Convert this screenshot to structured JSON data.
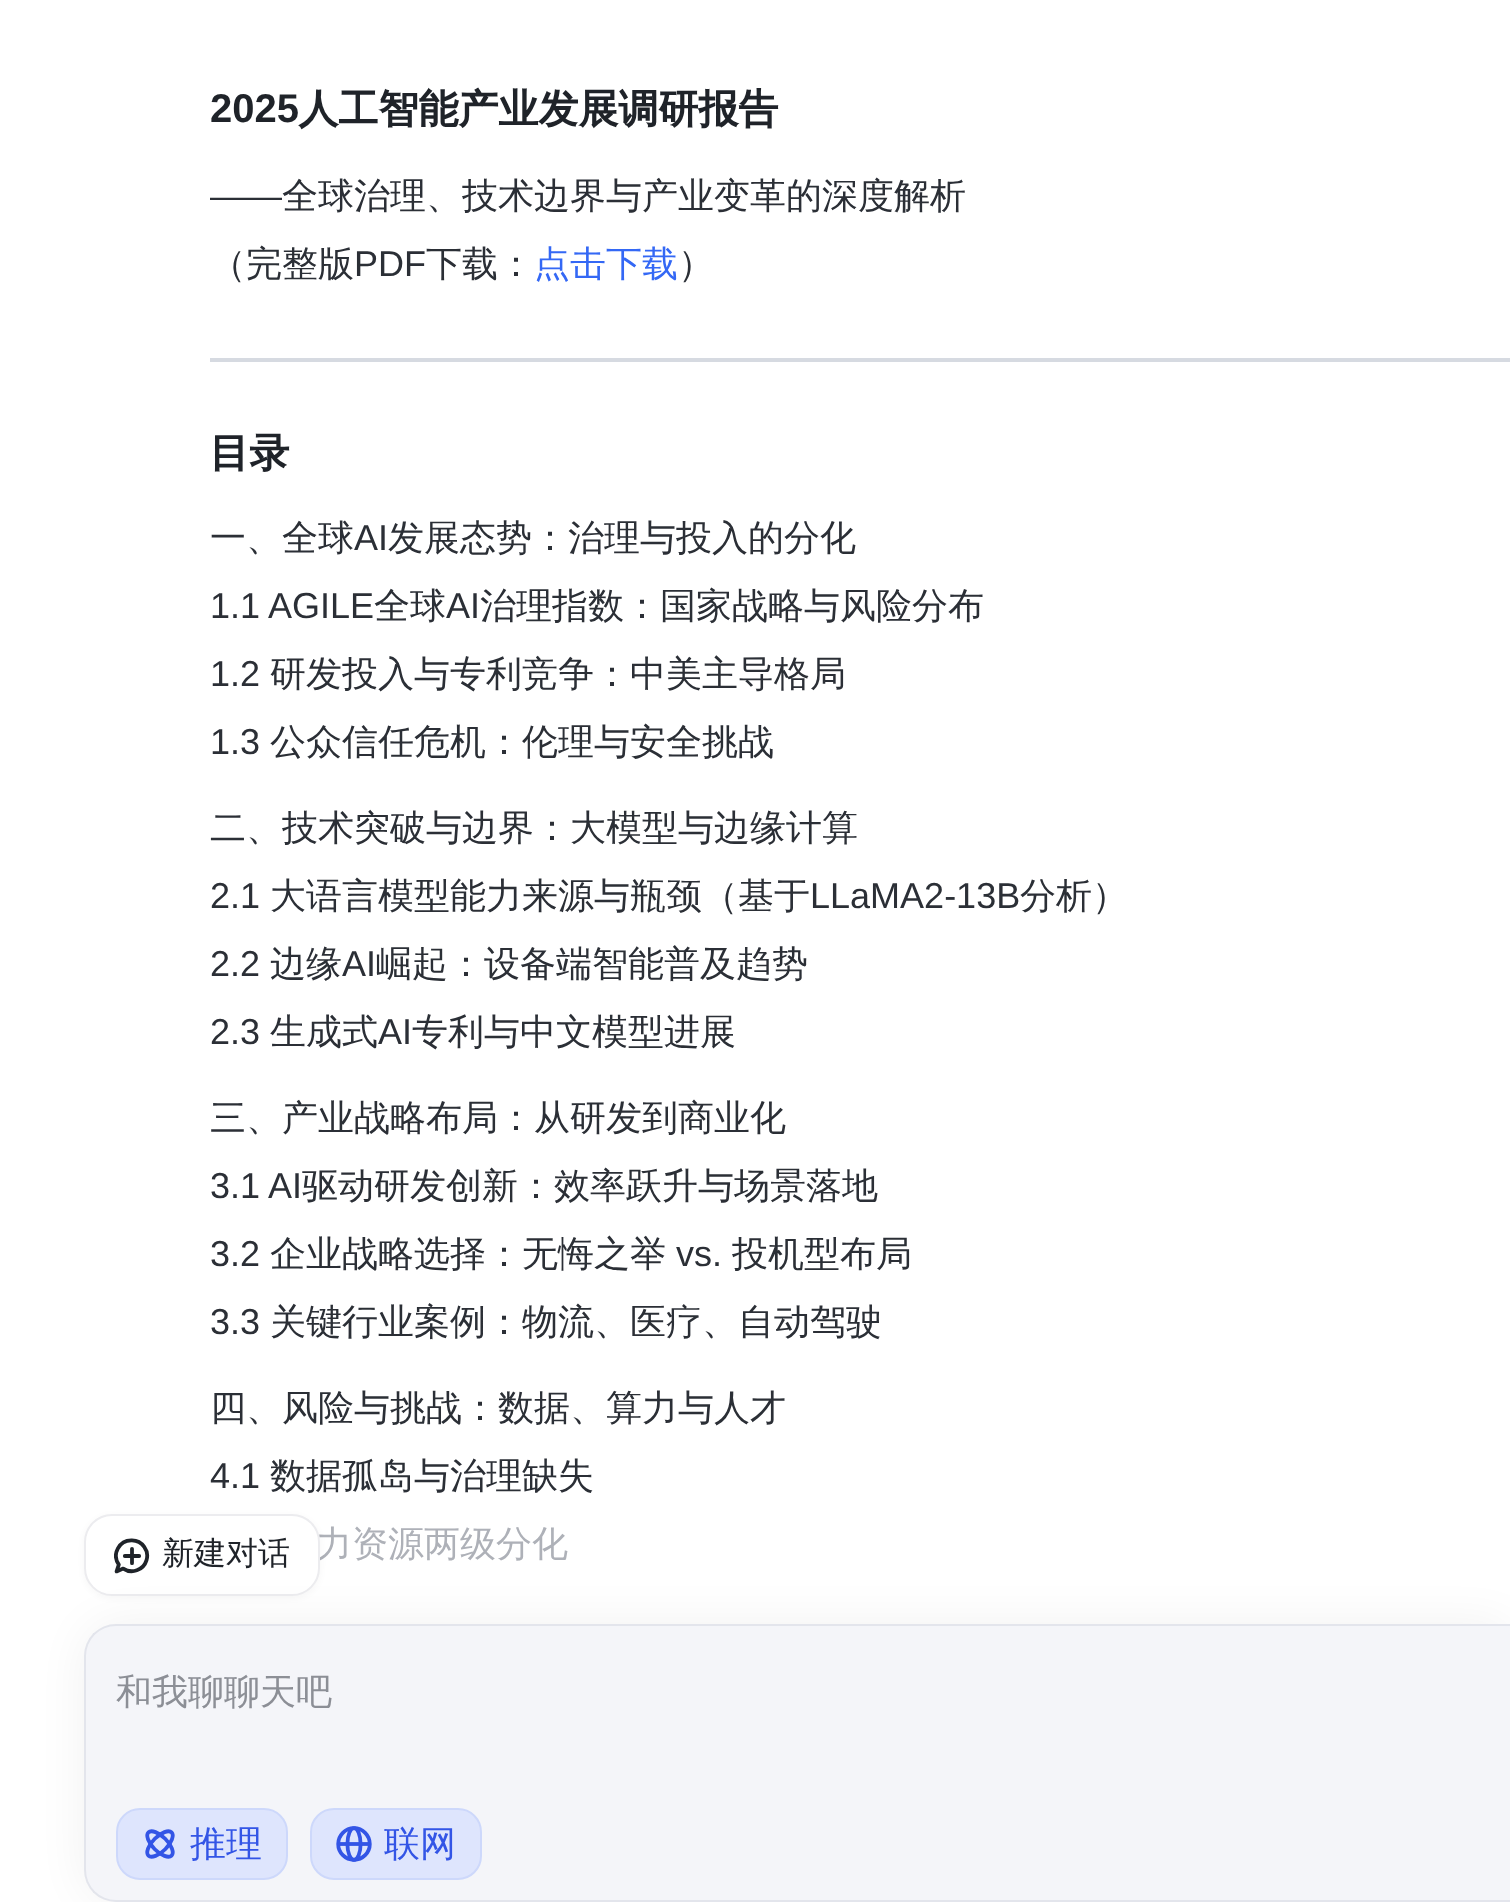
{
  "report": {
    "title": "2025人工智能产业发展调研报告",
    "subtitle": "——全球治理、技术边界与产业变革的深度解析",
    "download": {
      "prefix": "（完整版PDF下载：",
      "link": "点击下载",
      "suffix": "）"
    }
  },
  "toc": {
    "heading": "目录",
    "sections": [
      {
        "title": "一、全球AI发展态势：治理与投入的分化",
        "items": [
          {
            "text": "1.1 AGILE全球AI治理指数：国家战略与风险分布",
            "covered": false
          },
          {
            "text": "1.2 研发投入与专利竞争：中美主导格局",
            "covered": false
          },
          {
            "text": "1.3 公众信任危机：伦理与安全挑战",
            "covered": false
          }
        ]
      },
      {
        "title": "二、技术突破与边界：大模型与边缘计算",
        "items": [
          {
            "text": "2.1 大语言模型能力来源与瓶颈（基于LLaMA2-13B分析）",
            "covered": false
          },
          {
            "text": "2.2 边缘AI崛起：设备端智能普及趋势",
            "covered": false
          },
          {
            "text": "2.3 生成式AI专利与中文模型进展",
            "covered": false
          }
        ]
      },
      {
        "title": "三、产业战略布局：从研发到商业化",
        "items": [
          {
            "text": "3.1 AI驱动研发创新：效率跃升与场景落地",
            "covered": false
          },
          {
            "text": "3.2 企业战略选择：无悔之举 vs. 投机型布局",
            "covered": false
          },
          {
            "text": "3.3 关键行业案例：物流、医疗、自动驾驶",
            "covered": false
          }
        ]
      },
      {
        "title": "四、风险与挑战：数据、算力与人才",
        "items": [
          {
            "text": "4.1 数据孤岛与治理缺失",
            "covered": false
          },
          {
            "text": "力资源两级分化",
            "covered": true
          }
        ]
      }
    ]
  },
  "composer": {
    "new_chat": "新建对话",
    "placeholder": "和我聊聊天吧",
    "tools": [
      {
        "kind": "reasoning",
        "label": "推理"
      },
      {
        "kind": "web",
        "label": "联网"
      }
    ]
  }
}
